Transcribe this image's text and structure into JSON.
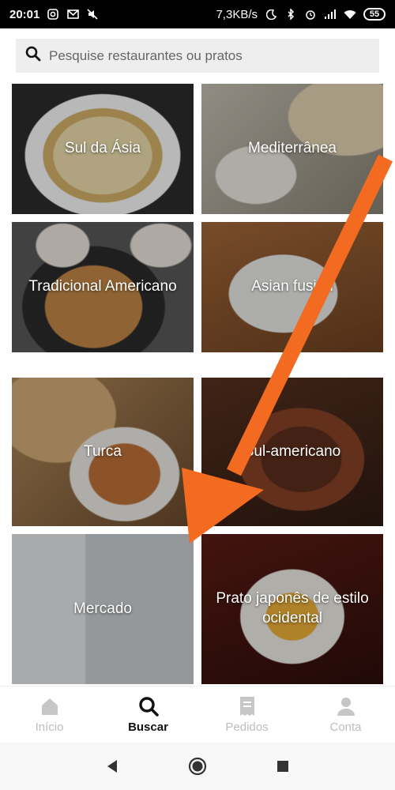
{
  "status_bar": {
    "time": "20:01",
    "network_speed": "7,3KB/s",
    "battery": "55",
    "icons_left": [
      "instagram-icon",
      "gmail-icon",
      "mute-icon"
    ],
    "icons_right": [
      "moon-icon",
      "bluetooth-icon",
      "alarm-icon",
      "signal-icon",
      "wifi-icon"
    ]
  },
  "search": {
    "placeholder": "Pesquise restaurantes ou pratos"
  },
  "categories": [
    {
      "label": "Sul da Ásia"
    },
    {
      "label": "Mediterrânea"
    },
    {
      "label": "Tradicional Americano"
    },
    {
      "label": "Asian fusion"
    },
    {
      "label": "Turca"
    },
    {
      "label": "Sul-americano"
    },
    {
      "label": "Mercado"
    },
    {
      "label": "Prato japonês de estilo ocidental"
    }
  ],
  "tabs": [
    {
      "label": "Início",
      "icon": "home-icon",
      "active": false
    },
    {
      "label": "Buscar",
      "icon": "search-icon",
      "active": true
    },
    {
      "label": "Pedidos",
      "icon": "receipt-icon",
      "active": false
    },
    {
      "label": "Conta",
      "icon": "person-icon",
      "active": false
    }
  ],
  "colors": {
    "arrow": "#f26b21",
    "active_tab": "#111111",
    "inactive_tab": "#bdbdbd"
  }
}
